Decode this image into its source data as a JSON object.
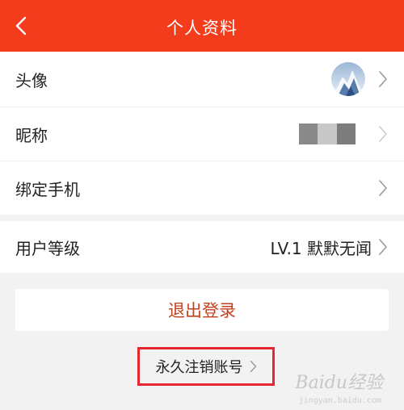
{
  "header": {
    "title": "个人资料",
    "background": "#f23c1c"
  },
  "profile": {
    "rows": [
      {
        "label": "头像",
        "value": "",
        "icon": "chevron-right-icon"
      },
      {
        "label": "昵称",
        "value": "",
        "icon": "chevron-right-icon"
      },
      {
        "label": "绑定手机",
        "value": "",
        "icon": "chevron-right-icon"
      }
    ]
  },
  "level": {
    "label": "用户等级",
    "value": "LV.1 默默无闻",
    "icon": "chevron-right-icon"
  },
  "actions": {
    "logout_label": "退出登录",
    "logout_color": "#c6401f",
    "cancel_account_label": "永久注销账号",
    "highlight_color": "#e8262d"
  },
  "watermark": {
    "text": "Baidu经验",
    "sub": "jingyan.baidu.com"
  }
}
